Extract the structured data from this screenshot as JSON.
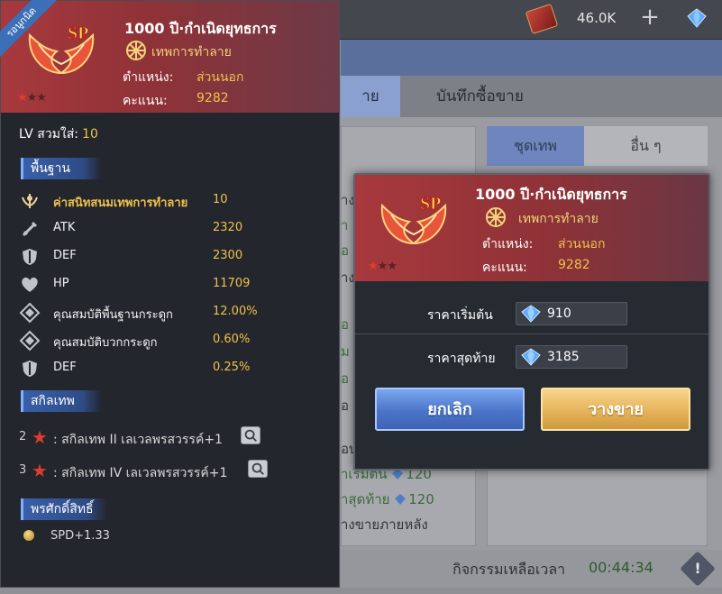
{
  "topbar": {
    "currency_value": "46.0K"
  },
  "background": {
    "tabs": [
      "าย",
      "บันทึกซื้อขาย"
    ],
    "subtabs": [
      "ชุดเทพ",
      "อื่น ๆ"
    ],
    "fragments": [
      "าง",
      "า",
      "อ",
      "าง",
      "อ",
      "ม",
      "อ",
      "อ",
      "าง",
      "อ",
      "าเริ่มต้น",
      "าสุดท้าย",
      "างขายภายหลัง",
      "อบ",
      "า",
      "น"
    ],
    "frag_values": [
      "120",
      "120"
    ],
    "timer_label": "กิจกรรมเหลือเวลา",
    "timer_value": "00:44:34",
    "info_icon": "!"
  },
  "item": {
    "ribbon": "รอนูกนิด",
    "title": "1000 ปี·กำเนิดยุทธการ",
    "type": "เทพการทำลาย",
    "position_label": "ตำแหน่ง:",
    "position_value": "ส่วนนอก",
    "score_label": "คะแนน:",
    "score_value": "9282",
    "stars_on": "★",
    "stars_off": "★★"
  },
  "tooltip": {
    "lv_label": "LV สวมใส่:",
    "lv_value": "10",
    "base_section": "พื้นฐาน",
    "stats": [
      {
        "icon": "wing-emblem-icon",
        "name": "ค่าสนิทสนมเทพการทำลาย",
        "value": "10"
      },
      {
        "icon": "sword-icon",
        "name": "ATK",
        "value": "2320"
      },
      {
        "icon": "shield-icon",
        "name": "DEF",
        "value": "2300"
      },
      {
        "icon": "heart-icon",
        "name": "HP",
        "value": "11709"
      },
      {
        "icon": "diamond-icon",
        "name": "คุณสมบัติพื้นฐานกระดูก",
        "value": "12.00%"
      },
      {
        "icon": "diamond-icon",
        "name": "คุณสมบัติบวกกระดูก",
        "value": "0.60%"
      },
      {
        "icon": "shield-icon",
        "name": "DEF",
        "value": "0.25%"
      }
    ],
    "skill_section": "สกิลเทพ",
    "skills": [
      {
        "num": "2",
        "text": ": สกิลเทพ II เลเวลพรสวรรค์+1"
      },
      {
        "num": "3",
        "text": ": สกิลเทพ IV เลเวลพรสวรรค์+1"
      }
    ],
    "blessing_section": "พรศักดิ์สิทธิ์",
    "spd": "SPD+1.33"
  },
  "dialog": {
    "start_price_label": "ราคาเริ่มต้น",
    "start_price": "910",
    "end_price_label": "ราคาสุดท้าย",
    "end_price": "3185",
    "cancel_label": "ยกเลิก",
    "sell_label": "วางขาย"
  },
  "colors": {
    "header_red": "#a7393d",
    "gold_text": "#f0c14a",
    "cancel_blue": "#4b74c9",
    "sell_gold": "#e5b35a"
  }
}
